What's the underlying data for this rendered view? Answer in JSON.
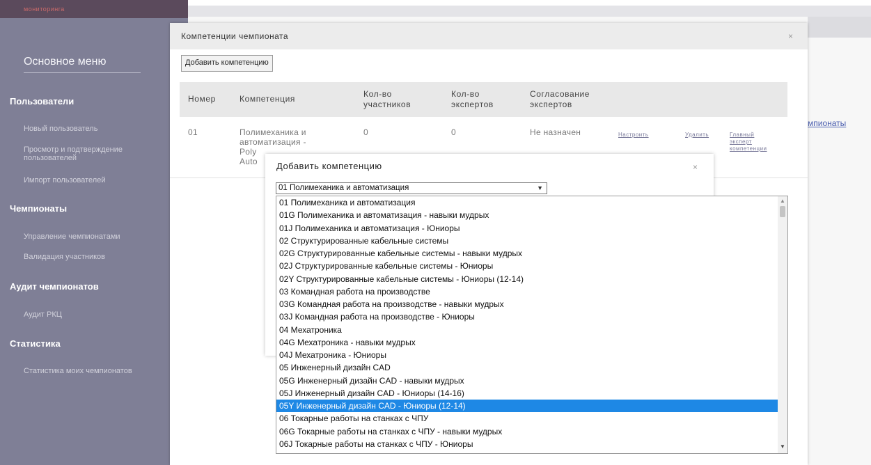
{
  "sidebar": {
    "top_text": "мониторинга",
    "menu_title": "Основное меню",
    "sections": [
      {
        "title": "Пользователи",
        "items": [
          "Новый пользователь",
          "Просмотр и подтверждение",
          "пользователей",
          "Импорт пользователей"
        ]
      },
      {
        "title": "Чемпионаты",
        "items": [
          "Управление чемпионатами",
          "Валидация участников"
        ]
      },
      {
        "title": "Аудит чемпионатов",
        "items": [
          "Аудит РКЦ"
        ]
      },
      {
        "title": "Статистика",
        "items": [
          "Статистика моих чемпионатов"
        ]
      }
    ]
  },
  "background": {
    "partial_link": "мпионаты"
  },
  "modal": {
    "title": "Компетенции чемпионата",
    "close_icon": "×",
    "add_button": "Добавить компетенцию",
    "columns": [
      "Номер",
      "Компетенция",
      "Кол-во\nучастников",
      "Кол-во\nэкспертов",
      "Согласование\nэкспертов"
    ],
    "row": {
      "number": "01",
      "competence": "Полимеханика и\nавтоматизация -\nPoly\nAuto",
      "participants": "0",
      "experts": "0",
      "status": "Не назначен",
      "actions": [
        "Настроить",
        "Удалить",
        "Главный\nэксперт\nкомпетенции"
      ]
    }
  },
  "inner_modal": {
    "title": "Добавить компетенцию",
    "close_icon": "×",
    "selected_value": "01 Полимеханика и автоматизация",
    "chevron_icon": "⌄"
  },
  "dropdown": {
    "selected_index": 16,
    "options": [
      "01 Полимеханика и автоматизация",
      "01G Полимеханика и автоматизация - навыки мудрых",
      "01J Полимеханика и автоматизация - Юниоры",
      "02 Структурированные кабельные системы",
      "02G Структурированные кабельные системы - навыки мудрых",
      "02J Структурированные кабельные системы - Юниоры",
      "02Y Структурированные кабельные системы - Юниоры (12-14)",
      "03 Командная работа на производстве",
      "03G Командная работа на производстве - навыки мудрых",
      "03J Командная работа на производстве - Юниоры",
      "04 Мехатроника",
      "04G Мехатроника - навыки мудрых",
      "04J Мехатроника - Юниоры",
      "05 Инженерный дизайн CAD",
      "05G Инженерный дизайн CAD - навыки мудрых",
      "05J Инженерный дизайн CAD - Юниоры (14-16)",
      "05Y Инженерный дизайн CAD - Юниоры (12-14)",
      "06 Токарные работы на станках с ЧПУ",
      "06G Токарные работы на станках с ЧПУ - навыки мудрых",
      "06J Токарные работы на станках с ЧПУ - Юниоры"
    ]
  },
  "colors": {
    "sidebar": "#7f7f96",
    "selected_option": "#1e88e5"
  }
}
